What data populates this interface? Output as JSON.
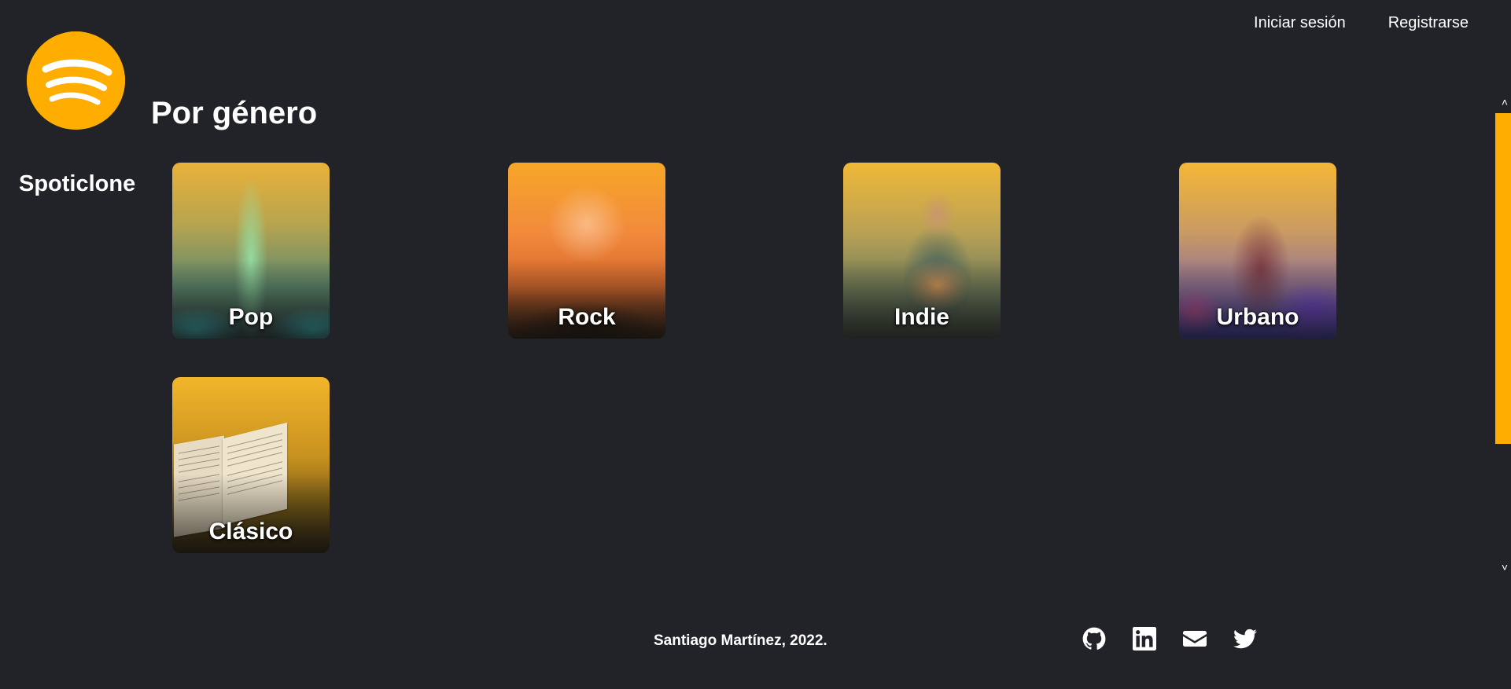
{
  "app": {
    "brand_name": "Spoticlone",
    "accent_color": "#ffae00",
    "background_color": "#212329"
  },
  "header": {
    "nav": {
      "login_label": "Iniciar sesión",
      "register_label": "Registrarse"
    }
  },
  "main": {
    "section_title": "Por género",
    "genres": [
      {
        "label": "Pop"
      },
      {
        "label": "Rock"
      },
      {
        "label": "Indie"
      },
      {
        "label": "Urbano"
      },
      {
        "label": "Clásico"
      }
    ]
  },
  "footer": {
    "credit": "Santiago Martínez, 2022.",
    "social_icons": [
      "github-icon",
      "linkedin-icon",
      "envelope-icon",
      "twitter-icon"
    ]
  }
}
